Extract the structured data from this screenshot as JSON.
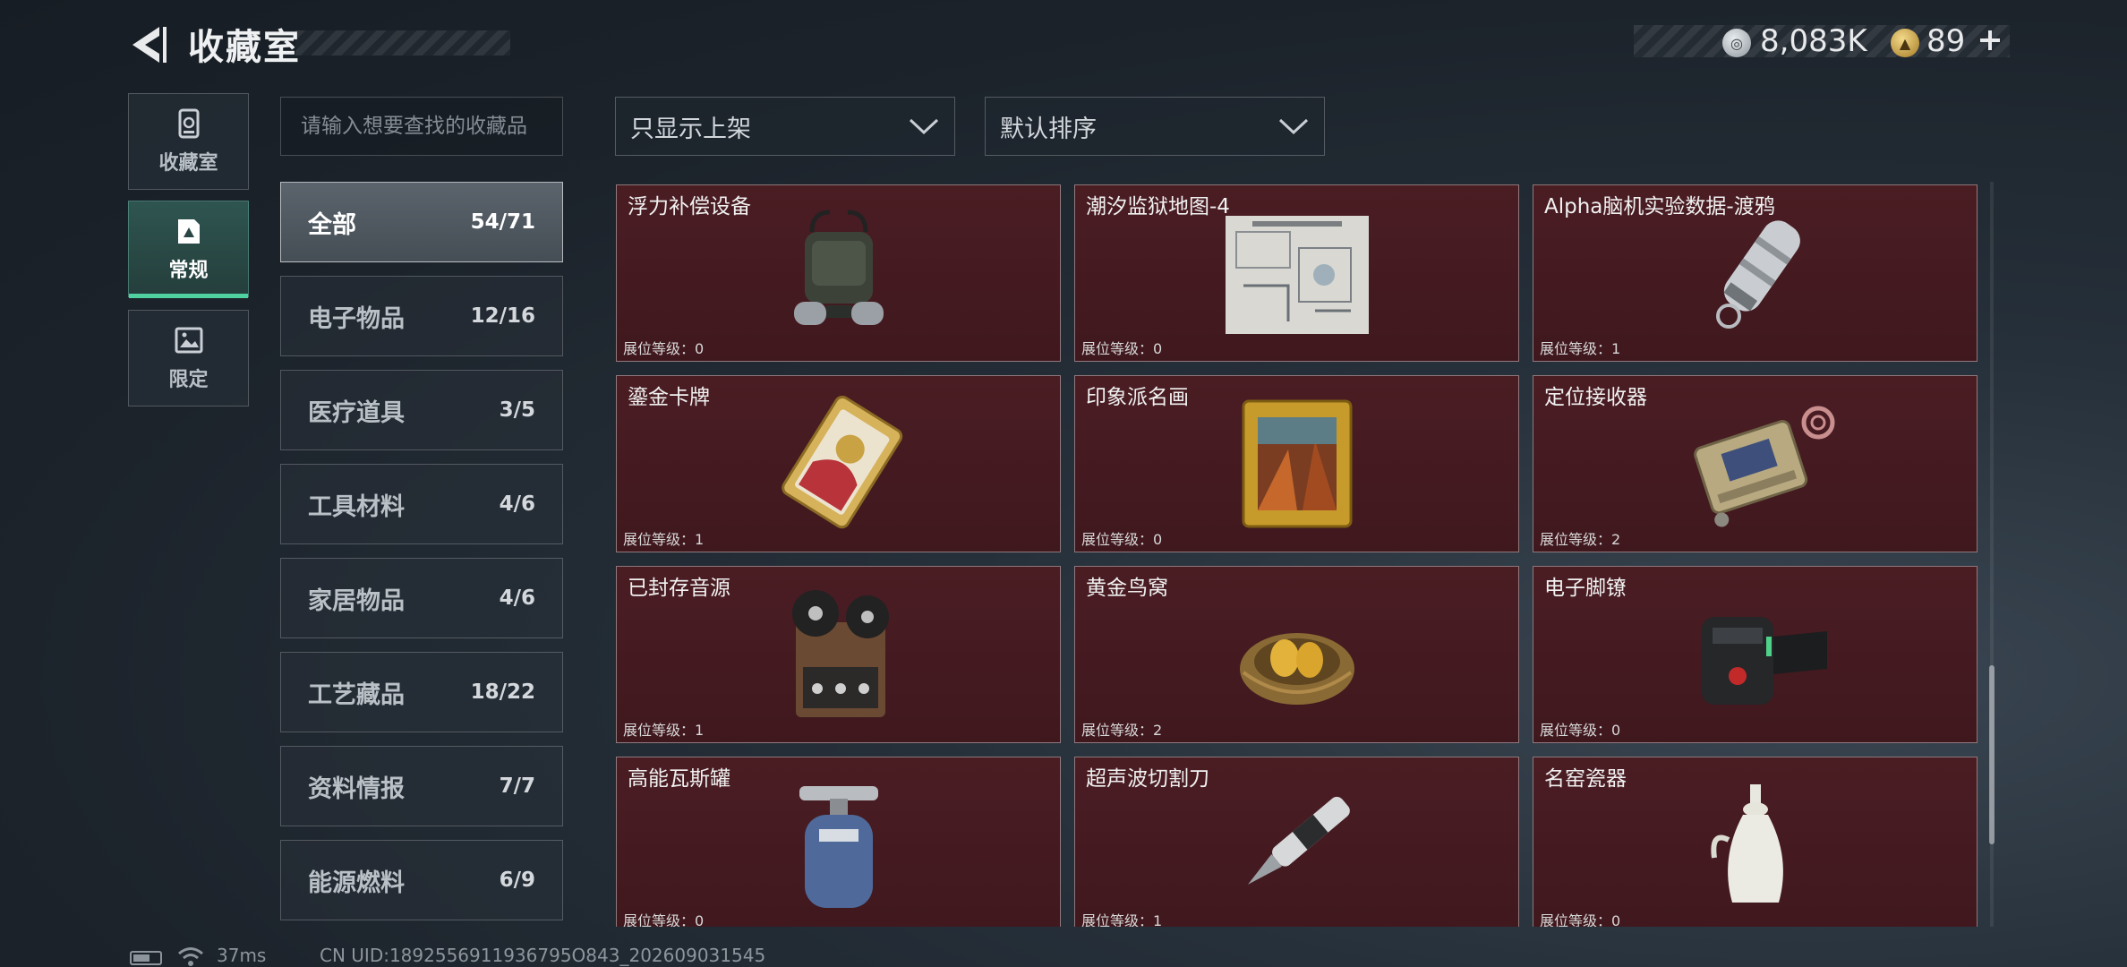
{
  "header": {
    "title": "收藏室",
    "currency": [
      {
        "icon": "silver-coin-icon",
        "value": "8,083K"
      },
      {
        "icon": "gold-coin-icon",
        "value": "89"
      }
    ]
  },
  "side_tabs": [
    {
      "label": "收藏室",
      "icon": "collection-room-icon",
      "active": false
    },
    {
      "label": "常规",
      "icon": "regular-document-icon",
      "active": true
    },
    {
      "label": "限定",
      "icon": "limited-image-icon",
      "active": false
    }
  ],
  "search": {
    "placeholder": "请输入想要查找的收藏品"
  },
  "categories": [
    {
      "name": "全部",
      "count": "54/71",
      "active": true
    },
    {
      "name": "电子物品",
      "count": "12/16"
    },
    {
      "name": "医疗道具",
      "count": "3/5"
    },
    {
      "name": "工具材料",
      "count": "4/6"
    },
    {
      "name": "家居物品",
      "count": "4/6"
    },
    {
      "name": "工艺藏品",
      "count": "18/22"
    },
    {
      "name": "资料情报",
      "count": "7/7"
    },
    {
      "name": "能源燃料",
      "count": "6/9"
    }
  ],
  "filters": {
    "listed_filter": "只显示上架",
    "sort": "默认排序"
  },
  "items": [
    {
      "name": "浮力补偿设备",
      "level": "展位等级：0",
      "icon": "buoyancy-device-icon"
    },
    {
      "name": "潮汐监狱地图-4",
      "level": "展位等级：0",
      "icon": "prison-map-icon"
    },
    {
      "name": "Alpha脑机实验数据-渡鸦",
      "level": "展位等级：1",
      "icon": "data-canister-icon"
    },
    {
      "name": "鎏金卡牌",
      "level": "展位等级：1",
      "icon": "gilded-card-icon"
    },
    {
      "name": "印象派名画",
      "level": "展位等级：0",
      "icon": "framed-painting-icon"
    },
    {
      "name": "定位接收器",
      "level": "展位等级：2",
      "icon": "locator-receiver-icon"
    },
    {
      "name": "已封存音源",
      "level": "展位等级：1",
      "icon": "reel-tape-recorder-icon"
    },
    {
      "name": "黄金鸟窝",
      "level": "展位等级：2",
      "icon": "golden-nest-icon"
    },
    {
      "name": "电子脚镣",
      "level": "展位等级：0",
      "icon": "ankle-monitor-icon"
    },
    {
      "name": "高能瓦斯罐",
      "level": "展位等级：0",
      "icon": "gas-canister-icon"
    },
    {
      "name": "超声波切割刀",
      "level": "展位等级：1",
      "icon": "ultrasonic-knife-icon"
    },
    {
      "name": "名窑瓷器",
      "level": "展位等级：0",
      "icon": "porcelain-vase-icon"
    }
  ],
  "status_bar": {
    "ping": "37ms",
    "uid": "CN UID:1892556911936795O843_202609031545"
  },
  "colors": {
    "card_bg": "#44191f",
    "accent_green": "#4fd1a0",
    "page_bg": "#1c232b"
  }
}
